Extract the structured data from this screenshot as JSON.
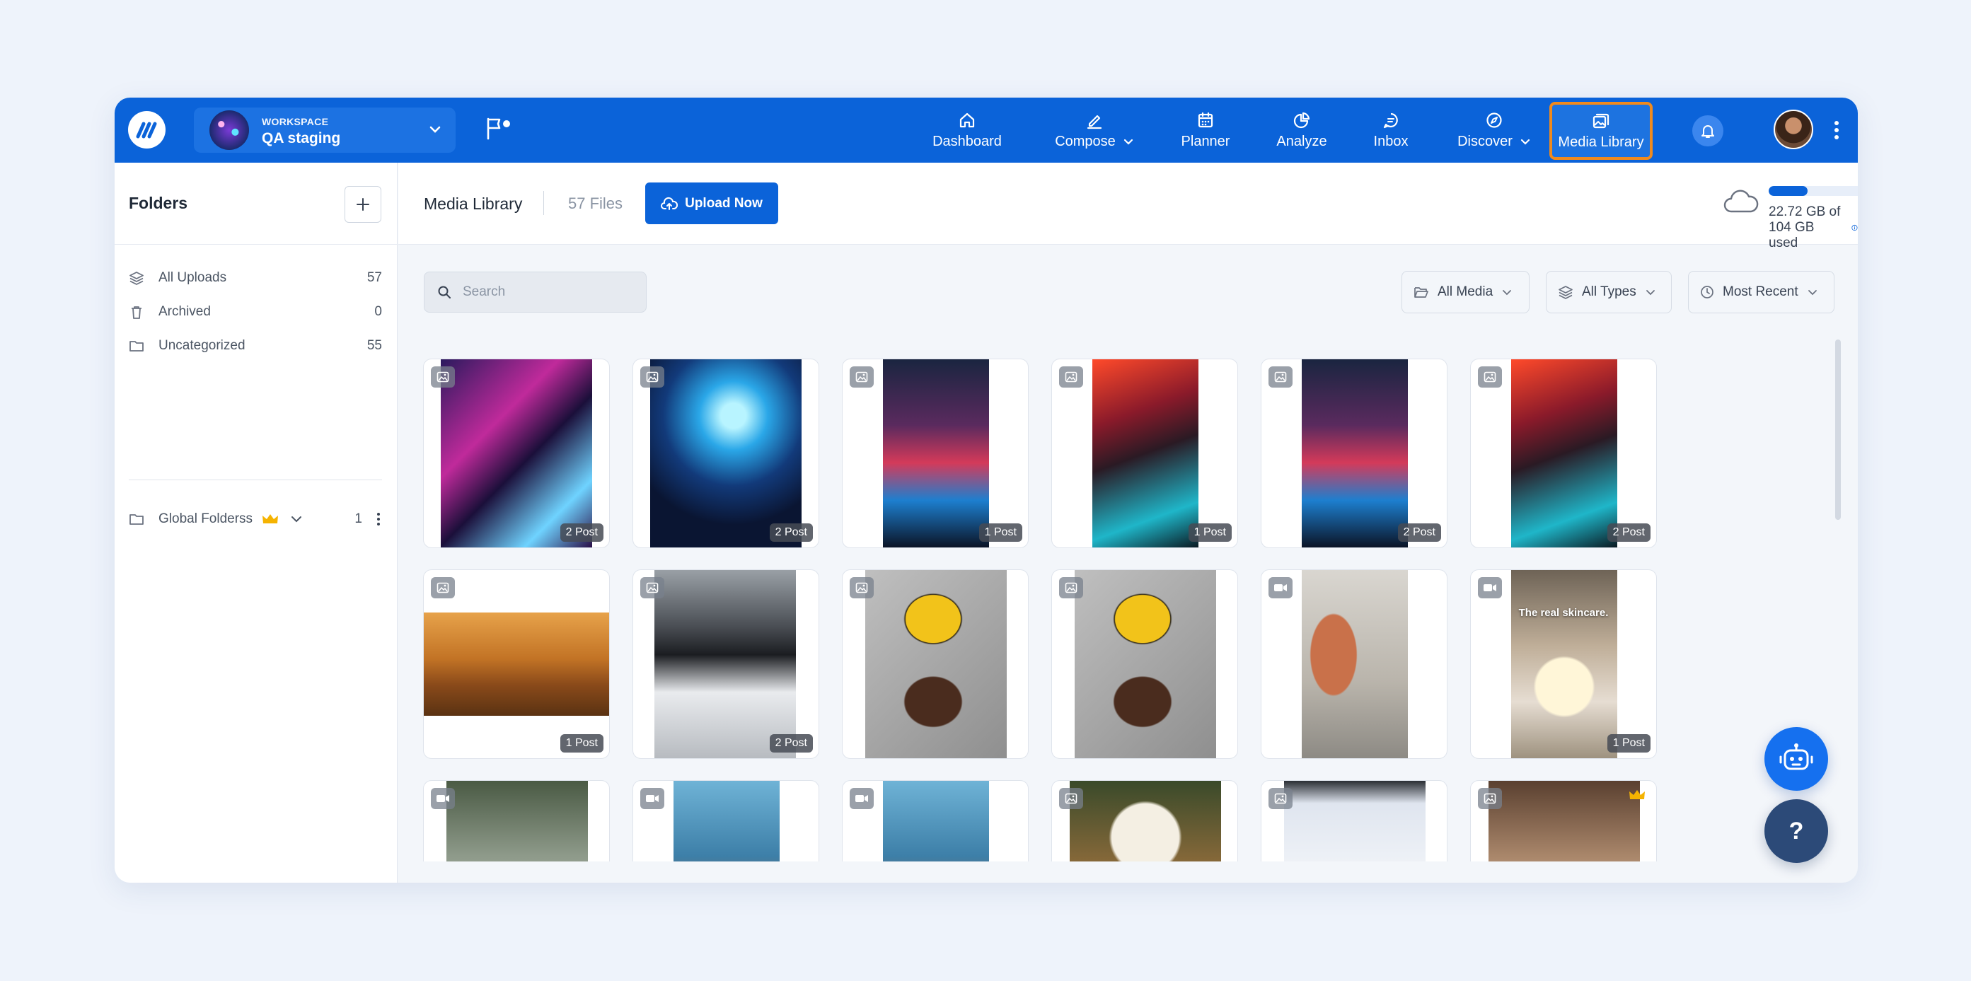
{
  "nav": {
    "workspace_label": "WORKSPACE",
    "workspace_name": "QA staging",
    "items": [
      {
        "label": "Dashboard",
        "icon": "home-icon"
      },
      {
        "label": "Compose",
        "icon": "pen-icon"
      },
      {
        "label": "Planner",
        "icon": "calendar-icon"
      },
      {
        "label": "Analyze",
        "icon": "pie-chart-icon"
      },
      {
        "label": "Inbox",
        "icon": "chat-bubble-icon"
      },
      {
        "label": "Discover",
        "icon": "compass-icon"
      },
      {
        "label": "Media Library",
        "icon": "images-icon"
      }
    ]
  },
  "sidebar": {
    "title": "Folders",
    "items": [
      {
        "label": "All Uploads",
        "count": "57",
        "icon": "layers-icon"
      },
      {
        "label": "Archived",
        "count": "0",
        "icon": "trash-icon"
      },
      {
        "label": "Uncategorized",
        "count": "55",
        "icon": "folder-icon"
      }
    ],
    "global_folder": {
      "label": "Global Folderss",
      "count": "1",
      "icon": "folder-icon"
    }
  },
  "header": {
    "title": "Media Library",
    "file_count": "57 Files",
    "upload_label": "Upload Now",
    "storage_text": "22.72 GB of 104 GB used",
    "storage_used_fraction": 0.218
  },
  "toolbar": {
    "search_placeholder": "Search",
    "filters": [
      {
        "label": "All Media",
        "icon": "folder-open-icon"
      },
      {
        "label": "All Types",
        "icon": "layers-icon"
      },
      {
        "label": "Most Recent",
        "icon": "clock-icon"
      }
    ]
  },
  "media": {
    "rows": [
      [
        {
          "type": "image",
          "posts": "2 Post"
        },
        {
          "type": "image",
          "posts": "2 Post"
        },
        {
          "type": "image",
          "posts": "1 Post"
        },
        {
          "type": "image",
          "posts": "1 Post"
        },
        {
          "type": "image",
          "posts": "2 Post"
        },
        {
          "type": "image",
          "posts": "2 Post"
        }
      ],
      [
        {
          "type": "image",
          "posts": "1 Post"
        },
        {
          "type": "image",
          "posts": "2 Post"
        },
        {
          "type": "image",
          "posts": ""
        },
        {
          "type": "image",
          "posts": ""
        },
        {
          "type": "video",
          "posts": ""
        },
        {
          "type": "video",
          "posts": "1 Post",
          "overlay": "The real skincare."
        }
      ],
      [
        {
          "type": "video",
          "posts": ""
        },
        {
          "type": "video",
          "posts": ""
        },
        {
          "type": "video",
          "posts": ""
        },
        {
          "type": "image",
          "posts": ""
        },
        {
          "type": "image",
          "posts": ""
        },
        {
          "type": "image",
          "posts": ""
        }
      ]
    ]
  },
  "floating": {
    "help_label": "?"
  }
}
